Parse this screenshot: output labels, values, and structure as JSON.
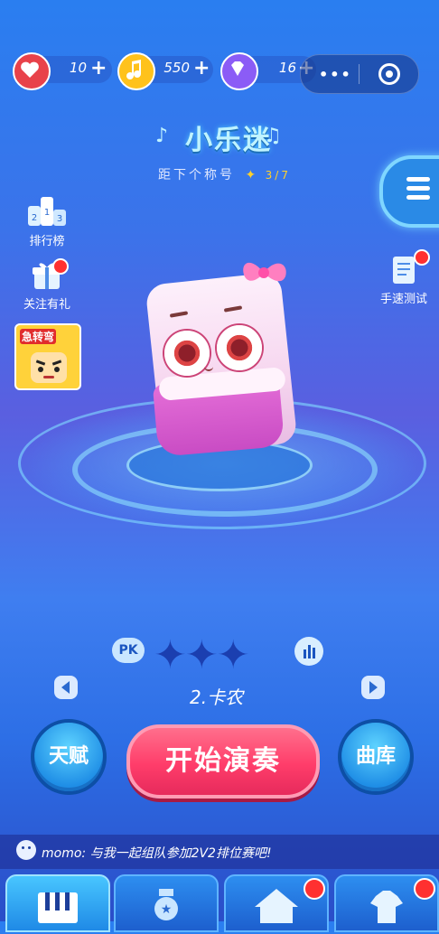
{
  "resources": {
    "hearts": "10",
    "coins": "550",
    "gems": "16"
  },
  "colors": {
    "heart": "#e8424a",
    "coin": "#ffc21c",
    "gem": "#8b5cf6",
    "start_button": "#ff3d6a",
    "accent_blue": "#1f8ee6"
  },
  "header": {
    "game_title": "小乐迷",
    "next_title_label": "距下个称号",
    "progress": "3/7"
  },
  "left_menu": {
    "leaderboard_label": "排行榜",
    "follow_gift_label": "关注有礼",
    "promo_game_label": "急转弯"
  },
  "right_menu": {
    "speed_test_label": "手速测试"
  },
  "song": {
    "pk_label": "PK",
    "stars_earned": 0,
    "stars_total": 3,
    "name": "2.卡农"
  },
  "actions": {
    "talent_label": "天赋",
    "start_label": "开始演奏",
    "library_label": "曲库"
  },
  "chat": {
    "message": "momo: 与我一起组队参加2V2排位赛吧!"
  },
  "tabs": [
    {
      "name": "piano-icon"
    },
    {
      "name": "medal-icon"
    },
    {
      "name": "home-icon"
    },
    {
      "name": "shirt-icon"
    }
  ]
}
